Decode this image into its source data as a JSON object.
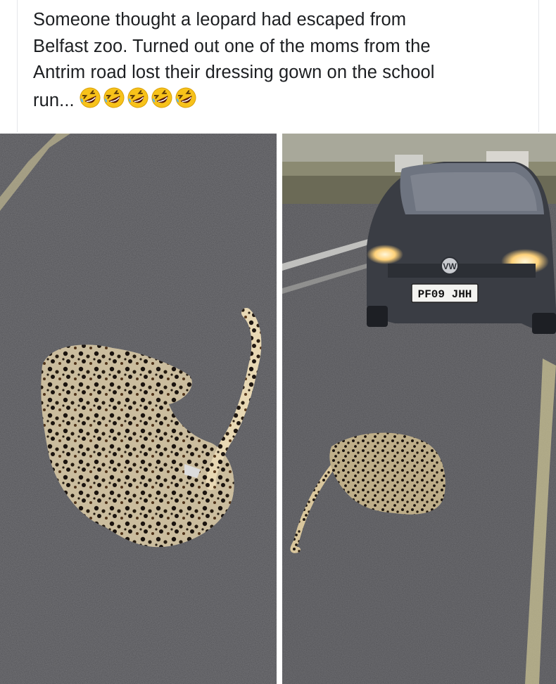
{
  "post": {
    "text_lines": [
      "Someone thought a leopard had escaped from",
      "Belfast zoo. Turned out one of the moms from the",
      "Antrim road  lost their dressing gown on the school",
      "run..."
    ],
    "emoji_icon": "rolling-on-floor-laughing-icon",
    "emoji_count": 5
  },
  "photos": {
    "left": {
      "subject": "leopard-print-dressing-gown-on-road"
    },
    "right": {
      "subject": "dressing-gown-in-front-of-car",
      "car_badge": "VW",
      "license_plate": "PF09 JHH"
    }
  },
  "colors": {
    "text": "#1c1e21",
    "asphalt": "#4f4f52",
    "road_line": "#d9cf9a",
    "car_body": "#3a3d44",
    "headlight": "#ffd27a"
  }
}
